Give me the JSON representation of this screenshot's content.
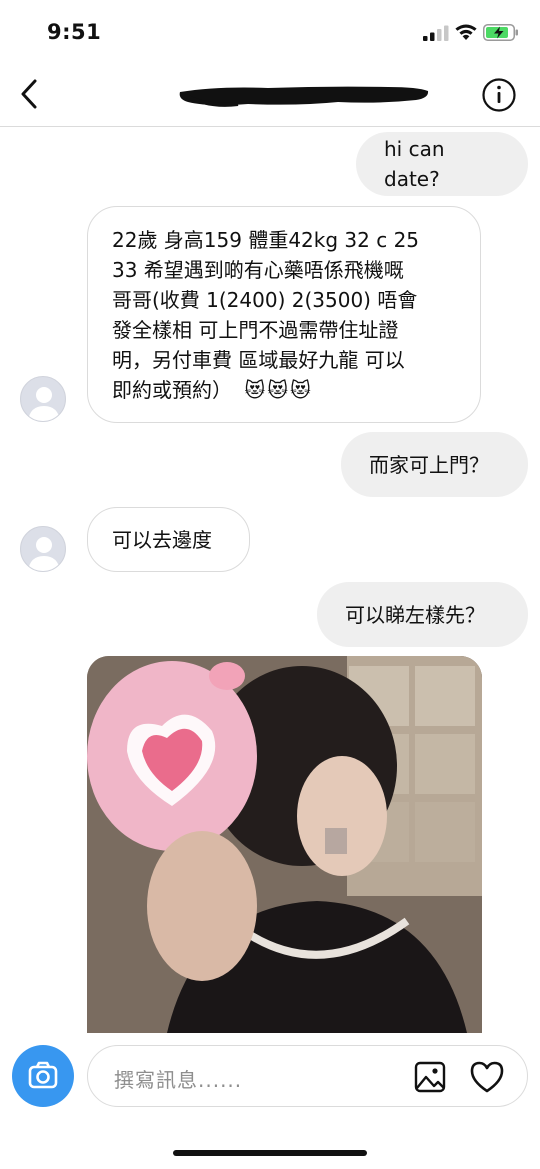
{
  "status_bar": {
    "time": "9:51",
    "icons": [
      "signal-icon",
      "wifi-icon",
      "battery-charging-icon"
    ]
  },
  "header": {
    "back_icon": "chevron-left-icon",
    "info_icon": "info-icon"
  },
  "messages": [
    {
      "direction": "outgoing",
      "text": "hi can date?"
    },
    {
      "direction": "incoming",
      "lines": [
        "22歲 身高159 體重42kg 32 c 25",
        "33 希望遇到啲有心藥唔係飛機嘅",
        "哥哥(收費 1(2400) 2(3500) 唔會",
        "發全樣相 可上門不過需帶住址證",
        "明，另付車費  區域最好九龍 可以",
        "即約或預約）"
      ],
      "emoji": "😻😻😻"
    },
    {
      "direction": "outgoing",
      "text": "而家可上門？"
    },
    {
      "direction": "incoming",
      "text": "可以去邊度"
    },
    {
      "direction": "outgoing",
      "text": "可以睇左樣先？"
    },
    {
      "direction": "incoming",
      "type": "photo"
    }
  ],
  "composer": {
    "placeholder": "撰寫訊息......",
    "camera_icon": "camera-icon",
    "gallery_icon": "image-icon",
    "like_icon": "heart-icon"
  },
  "colors": {
    "accent": "#3897f0",
    "outgoing_bubble": "#efefef",
    "incoming_border": "#dbdbdb",
    "placeholder": "#8e8e8e"
  }
}
